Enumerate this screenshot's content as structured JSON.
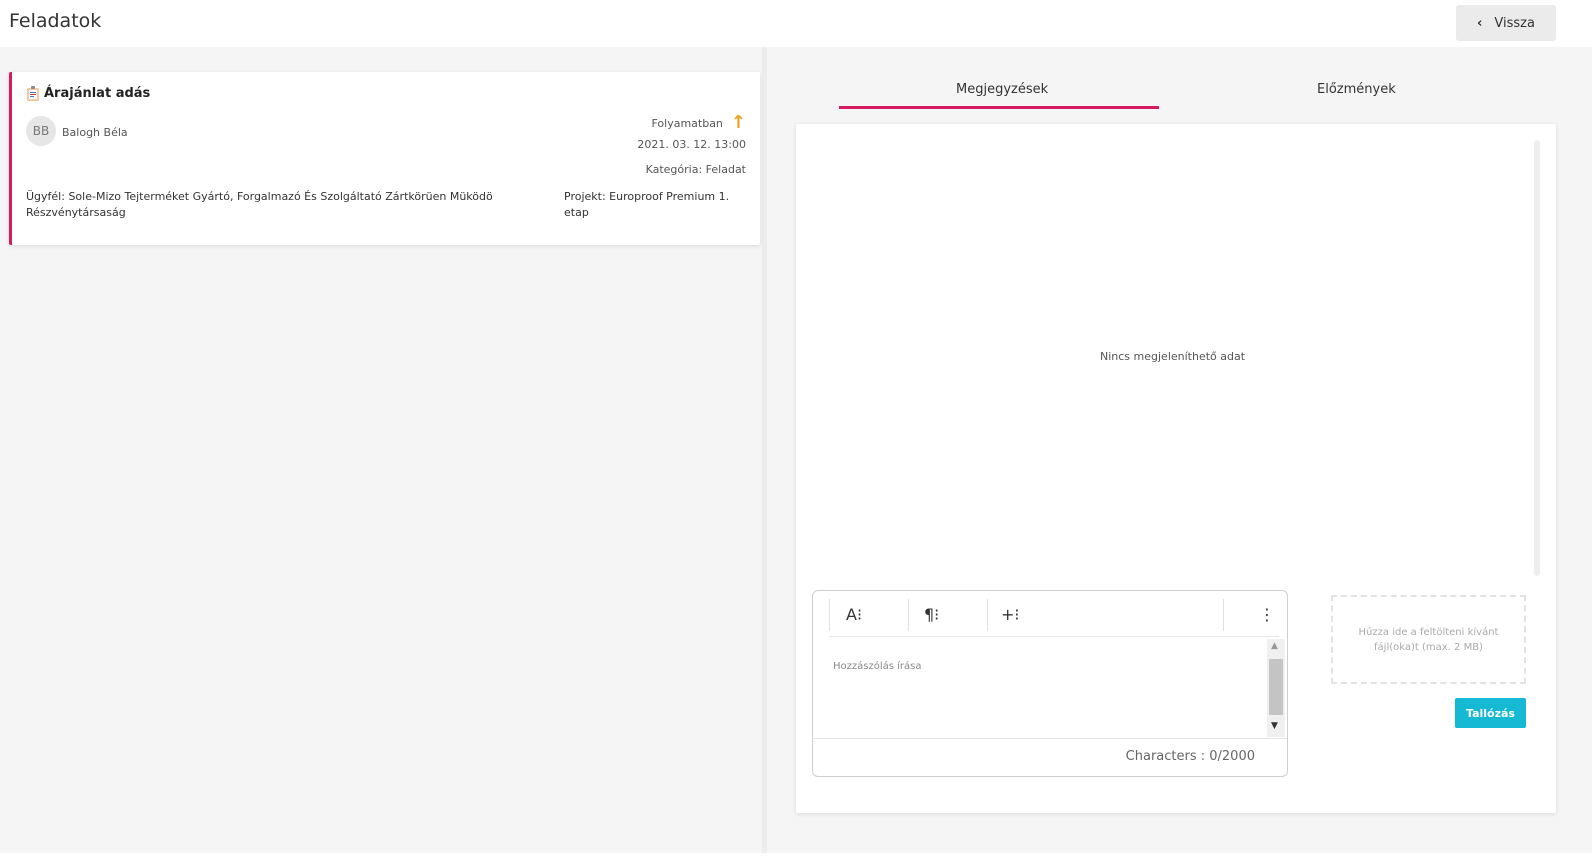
{
  "header": {
    "title": "Feladatok",
    "back_label": "Vissza"
  },
  "task": {
    "title": "Árajánlat adás",
    "assignee_initials": "BB",
    "assignee_name": "Balogh Béla",
    "status": "Folyamatban",
    "priority_icon": "arrow-up-icon",
    "date": "2021. 03. 12. 13:00",
    "category": "Kategória: Feladat",
    "customer": "Ügyfél: Sole-Mizo Tejterméket Gyártó, Forgalmazó És Szolgáltató Zártkörüen Müködö Részvénytársaság",
    "project": "Projekt: Europroof Premium 1. etap"
  },
  "tabs": [
    {
      "label": "Megjegyzések",
      "active": true
    },
    {
      "label": "Előzmények",
      "active": false
    }
  ],
  "notes": {
    "empty_text": "Nincs megjeleníthető adat",
    "editor": {
      "toolbar": [
        "A⁝",
        "¶⁝",
        "+⁝"
      ],
      "more": "⋮",
      "placeholder": "Hozzászólás írása",
      "char_count": "Characters : 0/2000"
    },
    "upload": {
      "dropzone_text": "Húzza ide a feltölteni kívánt fájl(oka)t (max. 2 MB)",
      "browse_label": "Tallózás"
    }
  },
  "colors": {
    "accent": "#d81b60",
    "priority": "#f0a020",
    "browse": "#16b9d4"
  }
}
